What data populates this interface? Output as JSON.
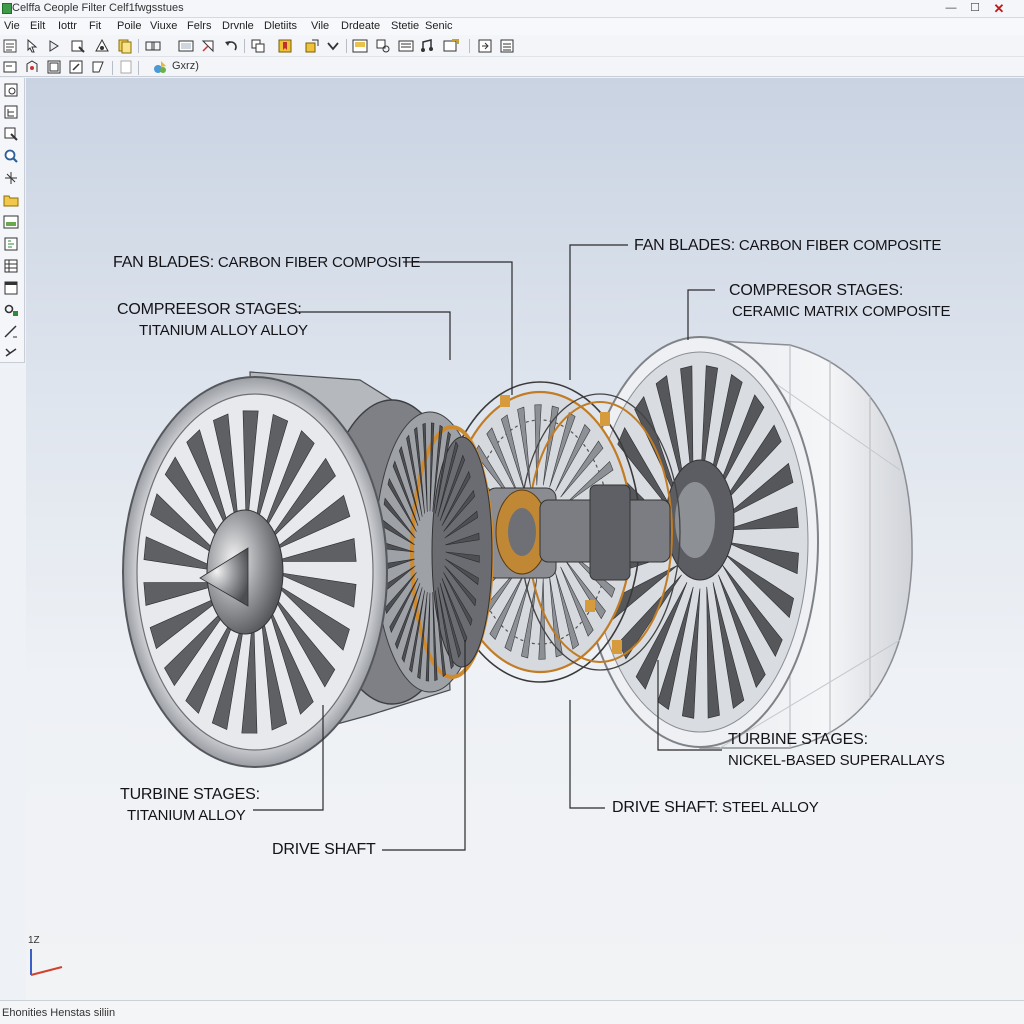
{
  "window": {
    "title": "Celffa Ceople Filter Celf1fwgsstues",
    "minimize_glyph": "—",
    "maximize_glyph": "☐",
    "close_glyph": "✕"
  },
  "menu": {
    "items": [
      "Vie",
      "Eilt",
      "Iottr",
      "Fit",
      "Poile",
      "Viuxe",
      "Felrs",
      "Drvnle",
      "Dletiits",
      "Vile",
      "Drdeate",
      "Stetie",
      "Senic"
    ]
  },
  "toolbar": {
    "mode_label": "Gxrz)"
  },
  "icons": {
    "app": "app-icon",
    "toolbar1": [
      "new-document-icon",
      "pointer-icon",
      "play-icon",
      "open-folder-icon",
      "assembly-icon",
      "copy-icon",
      "link-icon",
      "image-icon",
      "transform-icon",
      "undo-icon",
      "layout-icon",
      "bookmark-icon",
      "highlight-icon",
      "chevron-down-icon",
      "image-frame-icon",
      "settings-icon",
      "panel-icon",
      "sound-icon",
      "picture-icon",
      "export-icon",
      "list-icon"
    ],
    "toolbar2": [
      "sketch-icon",
      "grid-icon",
      "layers-icon",
      "edit-icon",
      "blank-page-icon",
      "smart-mode-icon"
    ],
    "sidebar": [
      "part-icon",
      "feature-tree-icon",
      "select-icon",
      "zoom-icon",
      "sparkle-icon",
      "folder-icon",
      "image-icon",
      "properties-icon",
      "table-icon",
      "window-icon",
      "magnet-icon",
      "cut-icon",
      "measure-icon"
    ]
  },
  "callouts": {
    "left_fan": {
      "head": "FAN BLADES:",
      "text": "CARBON FIBER COMPOSITE"
    },
    "left_compressor": {
      "head": "COMPREESOR STAGES:",
      "text": "TITANIUM ALLOY ALLOY"
    },
    "left_turbine": {
      "head": "TURBINE STAGES:",
      "text": "TITANIUM ALLOY"
    },
    "left_shaft": {
      "head": "DRIVE SHAFT",
      "text": ""
    },
    "right_fan": {
      "head": "FAN BLADES:",
      "text": "CARBON FIBER COMPOSITE"
    },
    "right_compressor": {
      "head": "COMPRESOR STAGES:",
      "text": "CERAMIC MATRIX COMPOSITE"
    },
    "right_turbine": {
      "head": "TURBINE STAGES:",
      "text": "NICKEL-BASED SUPERALLAYS"
    },
    "right_shaft": {
      "head": "DRIVE SHAFT:",
      "text": "STEEL ALLOY"
    }
  },
  "axis_label": "1Z",
  "status": {
    "text": "Ehonities Henstas siliin"
  },
  "colors": {
    "accent": "#d08a2e",
    "line": "#3a3a3a",
    "metal": "#6b6d72"
  }
}
